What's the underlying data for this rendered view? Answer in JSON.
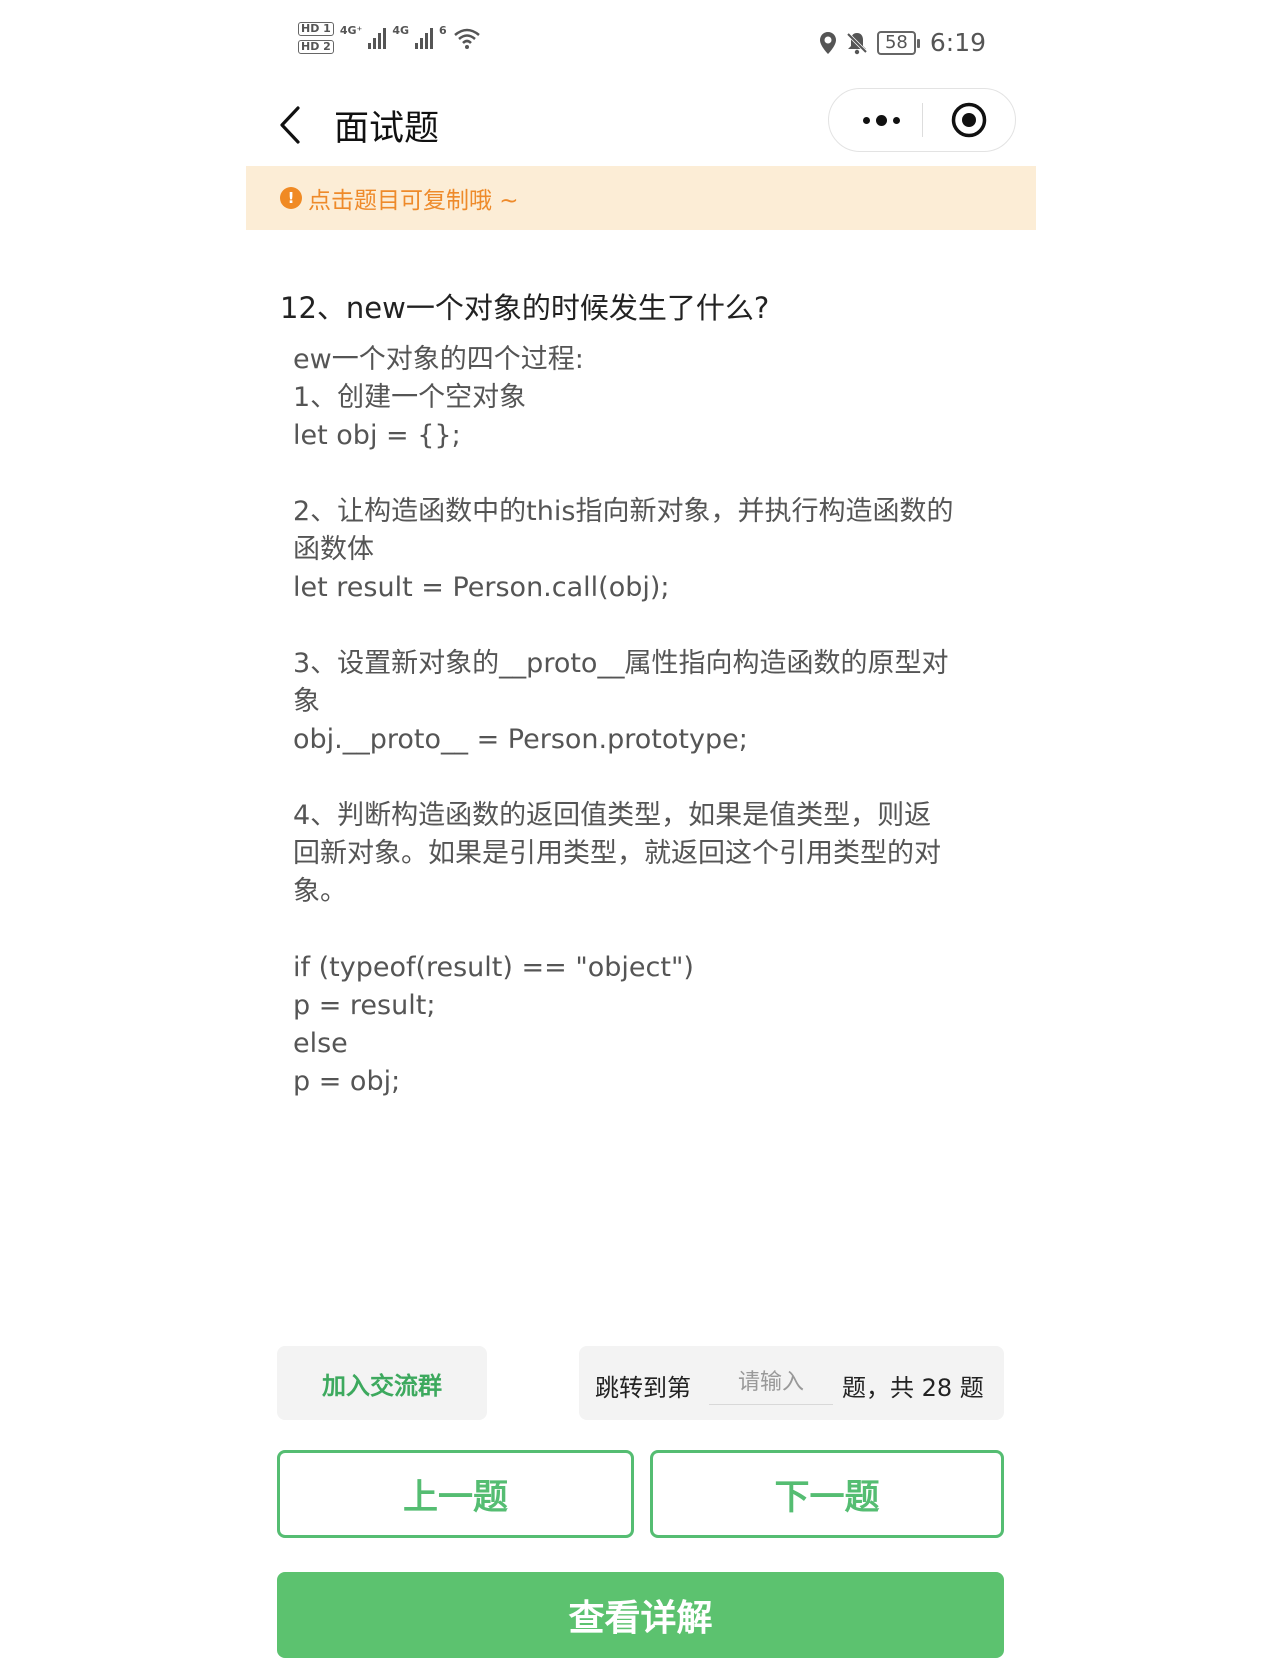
{
  "status_bar": {
    "sim1": "HD 1",
    "sim2": "HD 2",
    "net1": "4G⁺",
    "net2": "4G",
    "wifi_tag": "6",
    "battery": "58",
    "time": "6:19"
  },
  "nav": {
    "title": "面试题"
  },
  "tip": {
    "icon": "!",
    "text": "点击题目可复制哦 ~"
  },
  "question": {
    "title": "12、new一个对象的时候发生了什么?",
    "answer_lines": [
      "ew一个对象的四个过程:",
      "1、创建一个空对象",
      "let obj = {};",
      "",
      "2、让构造函数中的this指向新对象，并执行构造函数的",
      "函数体",
      "let result = Person.call(obj);",
      "",
      "3、设置新对象的__proto__属性指向构造函数的原型对",
      "象",
      "obj.__proto__ = Person.prototype;",
      "",
      "4、判断构造函数的返回值类型，如果是值类型，则返",
      "回新对象。如果是引用类型，就返回这个引用类型的对",
      "象。",
      "",
      "if (typeof(result) == \"object\")",
      "p = result;",
      "else",
      "p = obj;"
    ]
  },
  "footer": {
    "join_group": "加入交流群",
    "jump_prefix": "跳转到第",
    "jump_placeholder": "请输入",
    "jump_suffix": "题，共 28 题",
    "prev": "上一题",
    "next": "下一题",
    "detail": "查看详解"
  },
  "colors": {
    "accent_green": "#55bd72",
    "tip_bg": "#fcedd6",
    "tip_text": "#ee8a2a"
  },
  "icons": {
    "back": "chevron-left-icon",
    "more": "more-dots-icon",
    "close": "target-close-icon",
    "location": "location-pin-icon",
    "mute": "bell-off-icon",
    "wifi": "wifi-icon",
    "signal": "signal-bars-icon"
  }
}
